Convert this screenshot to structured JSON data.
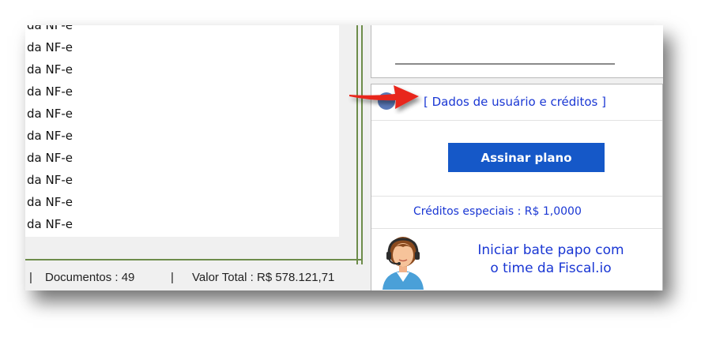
{
  "list": {
    "rows": [
      "da NF-e",
      "da NF-e",
      "da NF-e",
      "da NF-e",
      "da NF-e",
      "da NF-e",
      "da NF-e",
      "da NF-e",
      "da NF-e",
      "da NF-e"
    ]
  },
  "status": {
    "sep1": "|",
    "documentos": "Documentos : 49",
    "sep2": "|",
    "valor_total": "Valor Total : R$ 578.121,71"
  },
  "panel": {
    "user_link": "[ Dados de usuário e créditos ]",
    "plan_button": "Assinar plano",
    "credits": "Créditos especiais : R$ 1,0000",
    "chat_line1": "Iniciar bate papo com",
    "chat_line2": "o time da Fiscal.io"
  },
  "icons": {
    "user": "user-icon",
    "support": "support-agent-icon",
    "arrow": "red-arrow-icon"
  },
  "colors": {
    "link": "#1a37d4",
    "button": "#1558c8",
    "arrow": "#e8261c"
  }
}
